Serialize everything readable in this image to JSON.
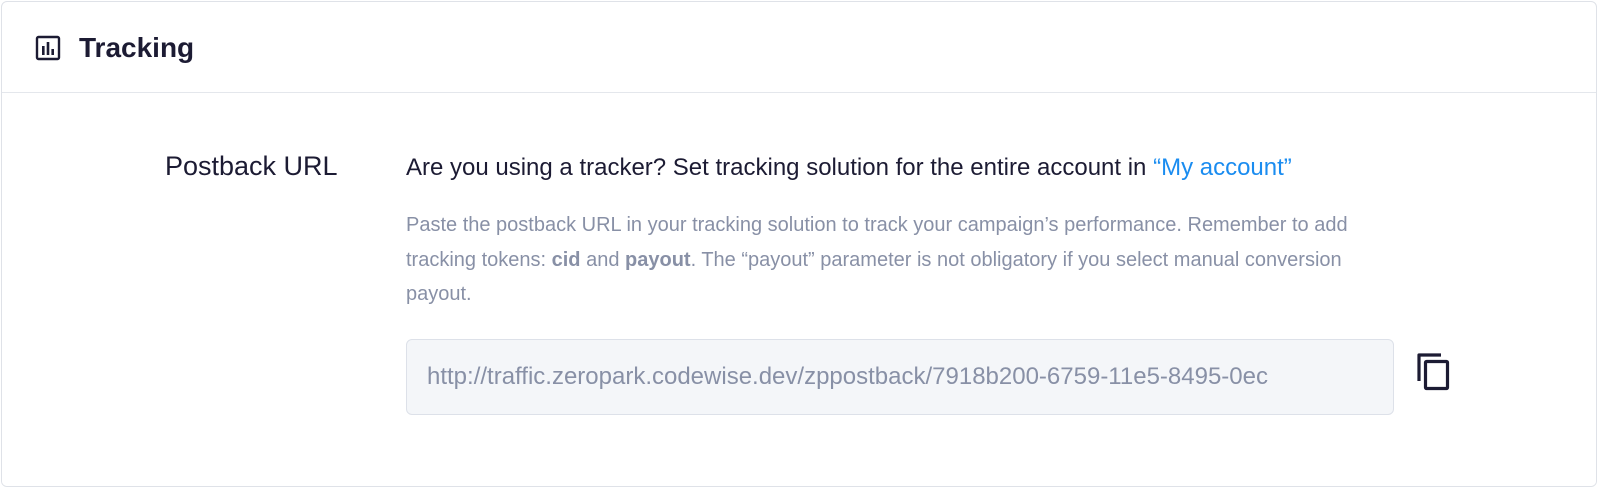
{
  "header": {
    "icon": "bar-chart-icon",
    "title": "Tracking"
  },
  "postback": {
    "label": "Postback URL",
    "question_text": "Are you using a tracker? Set tracking solution for the entire account in ",
    "account_link": "“My account”",
    "help": {
      "part1": "Paste the postback URL in your tracking solution to track your campaign’s performance. Remember to add tracking tokens: ",
      "token_cid": "cid",
      "and": " and ",
      "token_payout": "payout",
      "part2": ". The “payout” parameter is not obligatory if you select manual conversion payout."
    },
    "url_value": "http://traffic.zeropark.codewise.dev/zppostback/7918b200-6759-11e5-8495-0ec",
    "copy_icon": "copy-icon"
  },
  "colors": {
    "primary_text": "#1c1b33",
    "secondary_text": "#8890a6",
    "link": "#1a8cf0",
    "input_bg": "#f4f6f9",
    "border": "#dfe2e8"
  }
}
